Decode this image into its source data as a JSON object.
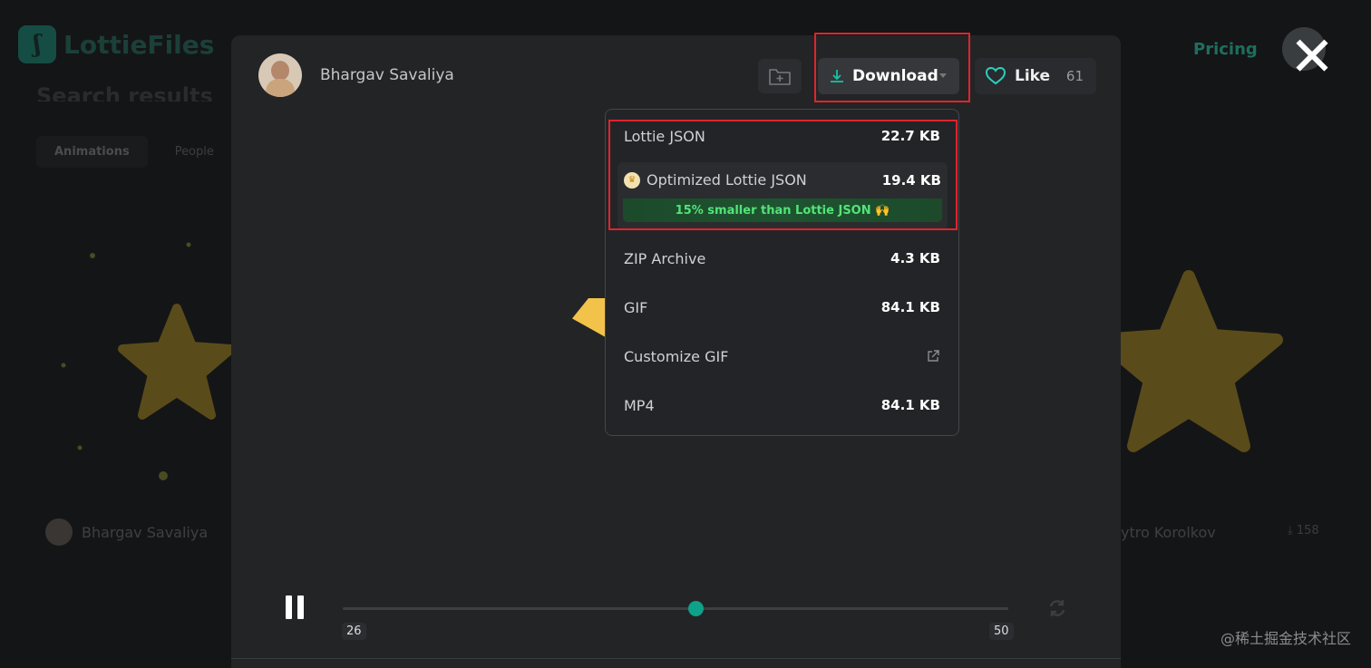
{
  "background": {
    "logo_text": "LottieFiles",
    "pricing_label": "Pricing",
    "heading": "Search results f",
    "tabs": [
      "Animations",
      "People"
    ],
    "left_author": "Bhargav Savaliya",
    "right_author": "ytro Korolkov",
    "right_download_count": "158",
    "watermark": "@稀土掘金技术社区"
  },
  "modal": {
    "author_name": "Bhargav Savaliya",
    "download_label": "Download",
    "like_label": "Like",
    "like_count": "61",
    "player": {
      "frame_start": "26",
      "frame_end": "50"
    }
  },
  "download_menu": {
    "items": [
      {
        "name": "Lottie JSON",
        "size": "22.7 KB"
      },
      {
        "name": "Optimized Lottie JSON",
        "size": "19.4 KB",
        "note": "15% smaller than Lottie JSON 🙌"
      },
      {
        "name": "ZIP Archive",
        "size": "4.3 KB"
      },
      {
        "name": "GIF",
        "size": "84.1 KB"
      },
      {
        "name": "Customize GIF",
        "size": ""
      },
      {
        "name": "MP4",
        "size": "84.1 KB"
      }
    ]
  },
  "colors": {
    "accent": "#0fa189",
    "highlight": "#e0242c",
    "star": "#5a4b1a"
  }
}
